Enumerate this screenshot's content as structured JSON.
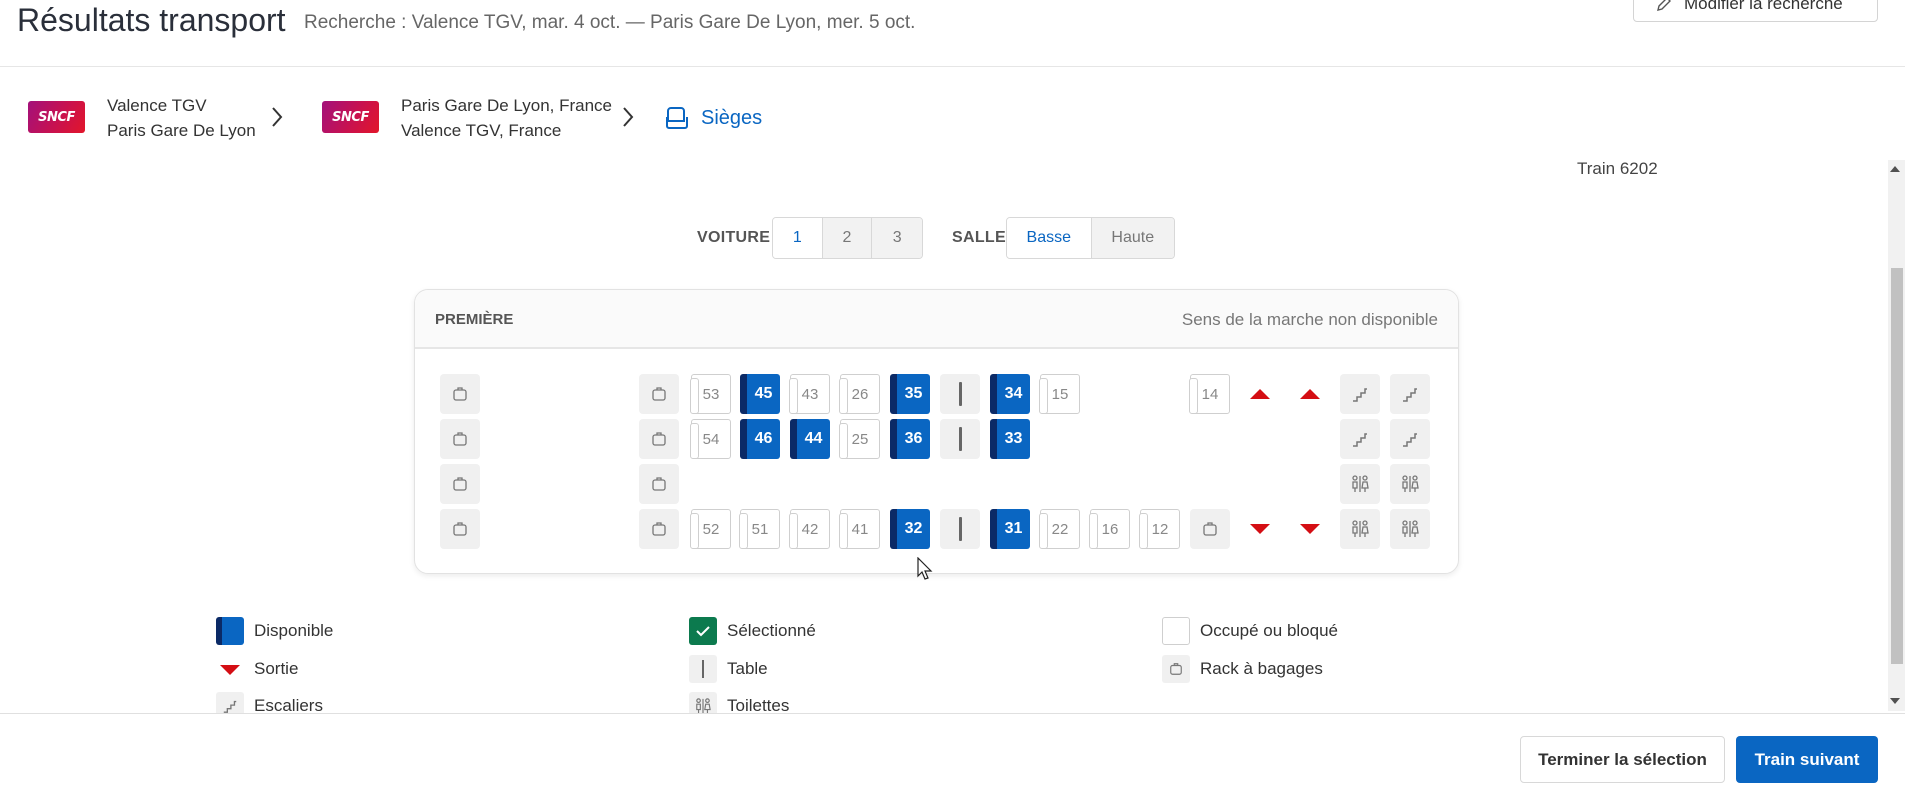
{
  "header": {
    "title": "Résultats transport",
    "search_summary": "Recherche : Valence TGV, mar. 4 oct. — Paris Gare De Lyon, mer. 5 oct.",
    "modify_label": "Modifier la recherche"
  },
  "breadcrumb": {
    "legs": [
      {
        "logo_text": "SNCF",
        "line1": "Valence TGV",
        "line2": "Paris Gare De Lyon"
      },
      {
        "logo_text": "SNCF",
        "line1": "Paris Gare De Lyon, France",
        "line2": "Valence TGV, France"
      }
    ],
    "seats_label": "Sièges"
  },
  "train_number": "Train 6202",
  "selectors": {
    "voiture_label": "VOITURE",
    "voitures": [
      "1",
      "2",
      "3"
    ],
    "voiture_selected": "1",
    "salle_label": "SALLE",
    "salles": [
      "Basse",
      "Haute"
    ],
    "salle_selected": "Basse"
  },
  "coach": {
    "class_label": "PREMIÈRE",
    "direction_label": "Sens de la marche non disponible",
    "seats": {
      "row1": {
        "s53": "53",
        "s45": "45",
        "s43": "43",
        "s26": "26",
        "s35": "35",
        "s34": "34",
        "s15": "15",
        "s14": "14"
      },
      "row2": {
        "s54": "54",
        "s46": "46",
        "s44": "44",
        "s25": "25",
        "s36": "36",
        "s33": "33"
      },
      "row4": {
        "s52": "52",
        "s51": "51",
        "s42": "42",
        "s41": "41",
        "s32": "32",
        "s31": "31",
        "s22": "22",
        "s16": "16",
        "s12": "12"
      }
    }
  },
  "legend": {
    "available": "Disponible",
    "selected": "Sélectionné",
    "occupied": "Occupé ou bloqué",
    "exit": "Sortie",
    "table": "Table",
    "rack": "Rack à bagages",
    "stairs": "Escaliers",
    "toilets": "Toilettes"
  },
  "footer": {
    "finish_label": "Terminer la sélection",
    "next_label": "Train suivant"
  },
  "colors": {
    "accent": "#0a66c2",
    "seat_available": "#0a66c2",
    "seat_selected": "#0c7a4e",
    "exit": "#d40e14"
  }
}
